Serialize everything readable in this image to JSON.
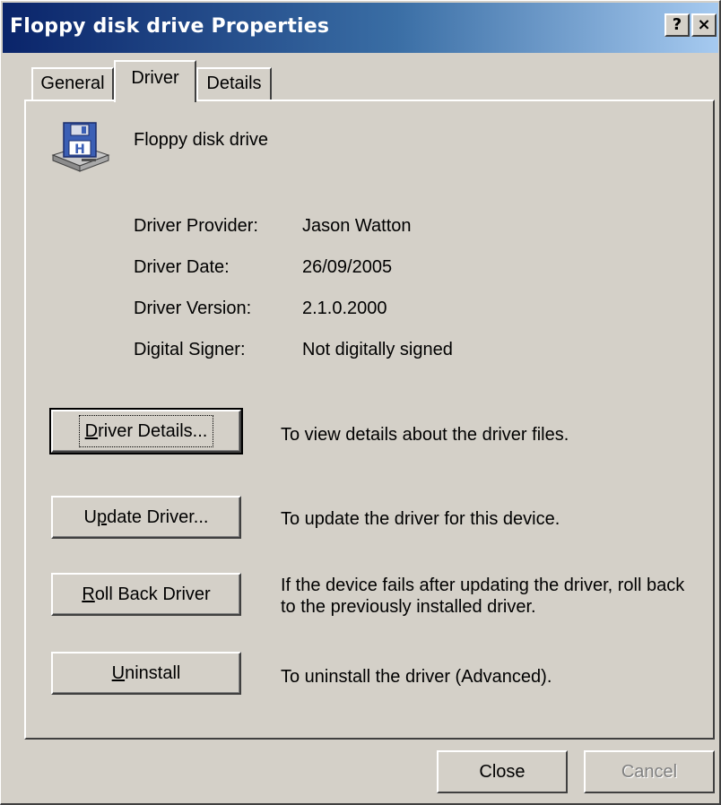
{
  "window": {
    "title": "Floppy disk drive Properties",
    "help_label": "?",
    "close_label": "×"
  },
  "tabs": [
    {
      "label": "General",
      "active": false
    },
    {
      "label": "Driver",
      "active": true
    },
    {
      "label": "Details",
      "active": false
    }
  ],
  "device": {
    "name": "Floppy disk drive",
    "icon": "floppy-drive-icon"
  },
  "driver_info": {
    "provider_label": "Driver Provider:",
    "provider_value": "Jason Watton",
    "date_label": "Driver Date:",
    "date_value": "26/09/2005",
    "version_label": "Driver Version:",
    "version_value": "2.1.0.2000",
    "signer_label": "Digital Signer:",
    "signer_value": "Not digitally signed"
  },
  "actions": {
    "details": {
      "mnemonic": "D",
      "rest": "river Details...",
      "desc": "To view details about the driver files."
    },
    "update": {
      "pre": "U",
      "mnemonic": "p",
      "rest": "date Driver...",
      "desc": "To update the driver for this device."
    },
    "rollback": {
      "mnemonic": "R",
      "rest": "oll Back Driver",
      "desc": "If the device fails after updating the driver, roll back to the previously installed driver."
    },
    "uninstall": {
      "mnemonic": "U",
      "rest": "ninstall",
      "desc": "To uninstall the driver (Advanced)."
    }
  },
  "footer": {
    "close_label": "Close",
    "cancel_label": "Cancel"
  },
  "colors": {
    "face": "#d4d0c8",
    "title_start": "#0a246a",
    "title_end": "#a6caf0"
  }
}
